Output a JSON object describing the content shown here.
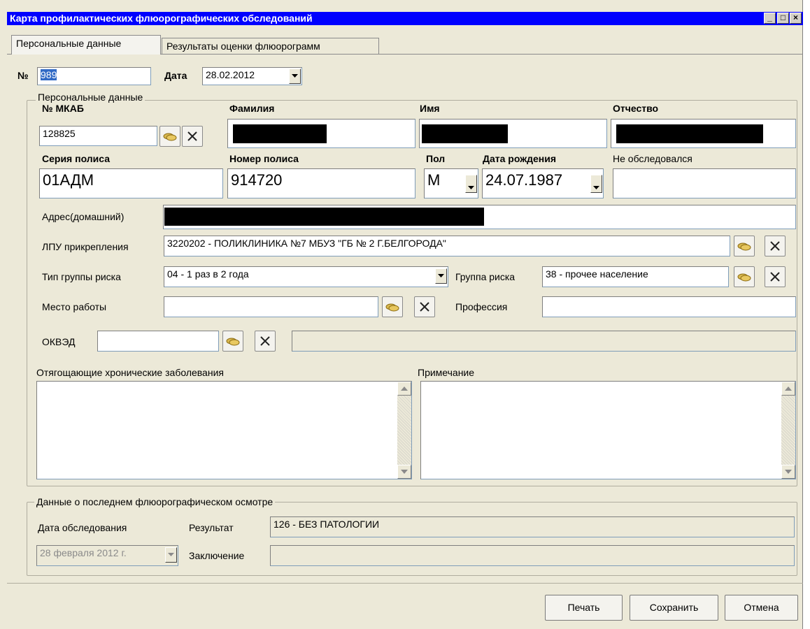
{
  "window": {
    "title": "Карта профилактических флюорографических обследований",
    "controls": {
      "minimize": "_",
      "maximize": "□",
      "close": "×"
    }
  },
  "tabs": [
    {
      "label": "Персональные данные",
      "active": true
    },
    {
      "label": "Результаты оценки флюорограмм",
      "active": false
    }
  ],
  "header": {
    "number_label": "№",
    "number_value": "989",
    "date_label": "Дата",
    "date_value": "28.02.2012"
  },
  "personal": {
    "group_title": "Персональные данные",
    "mkab_label": "№ МКАБ",
    "mkab_value": "128825",
    "surname_label": "Фамилия",
    "name_label": "Имя",
    "patronymic_label": "Отчество",
    "policy_series_label": "Серия полиса",
    "policy_series_value": "01АДМ",
    "policy_number_label": "Номер полиса",
    "policy_number_value": "914720",
    "sex_label": "Пол",
    "sex_value": "М",
    "birthdate_label": "Дата рождения",
    "birthdate_value": "24.07.1987",
    "not_examined_label": "Не обследовался",
    "address_label": "Адрес(домашний)",
    "lpu_label": "ЛПУ прикрепления",
    "lpu_value": "3220202 - ПОЛИКЛИНИКА №7  МБУЗ  \"ГБ  № 2 Г.БЕЛГОРОДА\"",
    "risk_type_label": "Тип группы риска",
    "risk_type_value": "04   - 1 раз в 2 года",
    "risk_group_label": "Группа риска",
    "risk_group_value": "38 - прочее население",
    "workplace_label": "Место работы",
    "workplace_value": "",
    "profession_label": "Профессия",
    "profession_value": "",
    "okved_label": "ОКВЭД",
    "okved_value": "",
    "chronic_label": "Отягощающие хронические заболевания",
    "chronic_value": "",
    "note_label": "Примечание",
    "note_value": ""
  },
  "last_exam": {
    "group_title": "Данные о последнем флюорографическом осмотре",
    "date_label": "Дата обследования",
    "date_value": "28 февраля  2012 г.",
    "result_label": "Результат",
    "result_value": "126   - БЕЗ ПАТОЛОГИИ",
    "conclusion_label": "Заключение",
    "conclusion_value": ""
  },
  "buttons": {
    "print": "Печать",
    "save": "Сохранить",
    "cancel": "Отмена"
  },
  "colors": {
    "titlebar": "#0000ff",
    "window_bg": "#ece9d8"
  }
}
